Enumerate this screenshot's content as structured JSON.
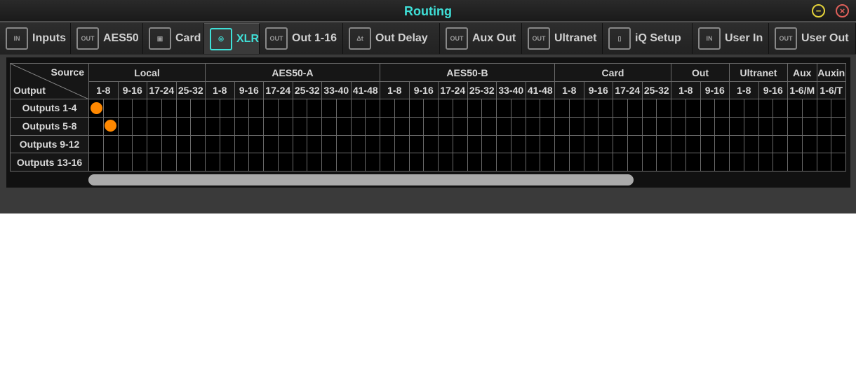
{
  "window": {
    "title": "Routing",
    "minimize_icon": "minus-circle-icon",
    "close_icon": "x-circle-icon"
  },
  "tabs": [
    {
      "label": "Inputs",
      "icon": "IN",
      "active": false
    },
    {
      "label": "AES50",
      "icon": "OUT",
      "active": false
    },
    {
      "label": "Card",
      "icon": "▣",
      "active": false
    },
    {
      "label": "XLR",
      "icon": "◎",
      "active": true
    },
    {
      "label": "Out 1-16",
      "icon": "OUT",
      "active": false
    },
    {
      "label": "Out Delay",
      "icon": "Δt",
      "active": false
    },
    {
      "label": "Aux Out",
      "icon": "OUT",
      "active": false
    },
    {
      "label": "Ultranet",
      "icon": "OUT",
      "active": false
    },
    {
      "label": "iQ Setup",
      "icon": "▯",
      "active": false
    },
    {
      "label": "User In",
      "icon": "IN",
      "active": false
    },
    {
      "label": "User Out",
      "icon": "OUT",
      "active": false
    }
  ],
  "matrix": {
    "corner_source": "Source",
    "corner_output": "Output",
    "groups": [
      {
        "name": "Local",
        "cols": [
          "1-8",
          "9-16",
          "17-24",
          "25-32"
        ]
      },
      {
        "name": "AES50-A",
        "cols": [
          "1-8",
          "9-16",
          "17-24",
          "25-32",
          "33-40",
          "41-48"
        ]
      },
      {
        "name": "AES50-B",
        "cols": [
          "1-8",
          "9-16",
          "17-24",
          "25-32",
          "33-40",
          "41-48"
        ]
      },
      {
        "name": "Card",
        "cols": [
          "1-8",
          "9-16",
          "17-24",
          "25-32"
        ]
      },
      {
        "name": "Out",
        "cols": [
          "1-8",
          "9-16"
        ]
      },
      {
        "name": "Ultranet",
        "cols": [
          "1-8",
          "9-16"
        ]
      },
      {
        "name": "Aux",
        "cols": [
          "1-6/M"
        ]
      },
      {
        "name": "Auxin",
        "cols": [
          "1-6/T"
        ]
      }
    ],
    "rows": [
      "Outputs 1-4",
      "Outputs 5-8",
      "Outputs 9-12",
      "Outputs 13-16"
    ],
    "routes": [
      {
        "row": 0,
        "cell": 0
      },
      {
        "row": 1,
        "cell": 1
      }
    ],
    "route_color": "#ff8800"
  },
  "scrollbar": {
    "position_fraction": 0.0,
    "visible_fraction": 0.72
  }
}
